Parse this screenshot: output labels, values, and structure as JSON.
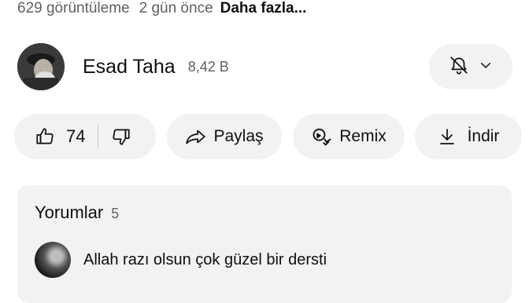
{
  "video_meta": {
    "views": "629 görüntüleme",
    "age": "2 gün önce",
    "more_label": "Daha fazla..."
  },
  "channel": {
    "name": "Esad Taha",
    "subscribers": "8,42 B",
    "avatar_icon": "channel-avatar",
    "notification_icon": "bell-off-icon",
    "dropdown_icon": "chevron-down-icon"
  },
  "actions": {
    "like_count": "74",
    "like_icon": "thumb-up-icon",
    "dislike_icon": "thumb-down-icon",
    "share_label": "Paylaş",
    "share_icon": "share-arrow-icon",
    "remix_label": "Remix",
    "remix_icon": "remix-icon",
    "download_label": "İndir",
    "download_icon": "download-icon"
  },
  "comments": {
    "title": "Yorumlar",
    "count": "5",
    "top_comment": {
      "text": "Allah razı olsun çok güzel bir dersti",
      "avatar_icon": "commenter-avatar"
    }
  },
  "colors": {
    "background": "#ffffff",
    "pill": "#f2f2f2",
    "text": "#0f0f0f",
    "muted": "#606060"
  }
}
